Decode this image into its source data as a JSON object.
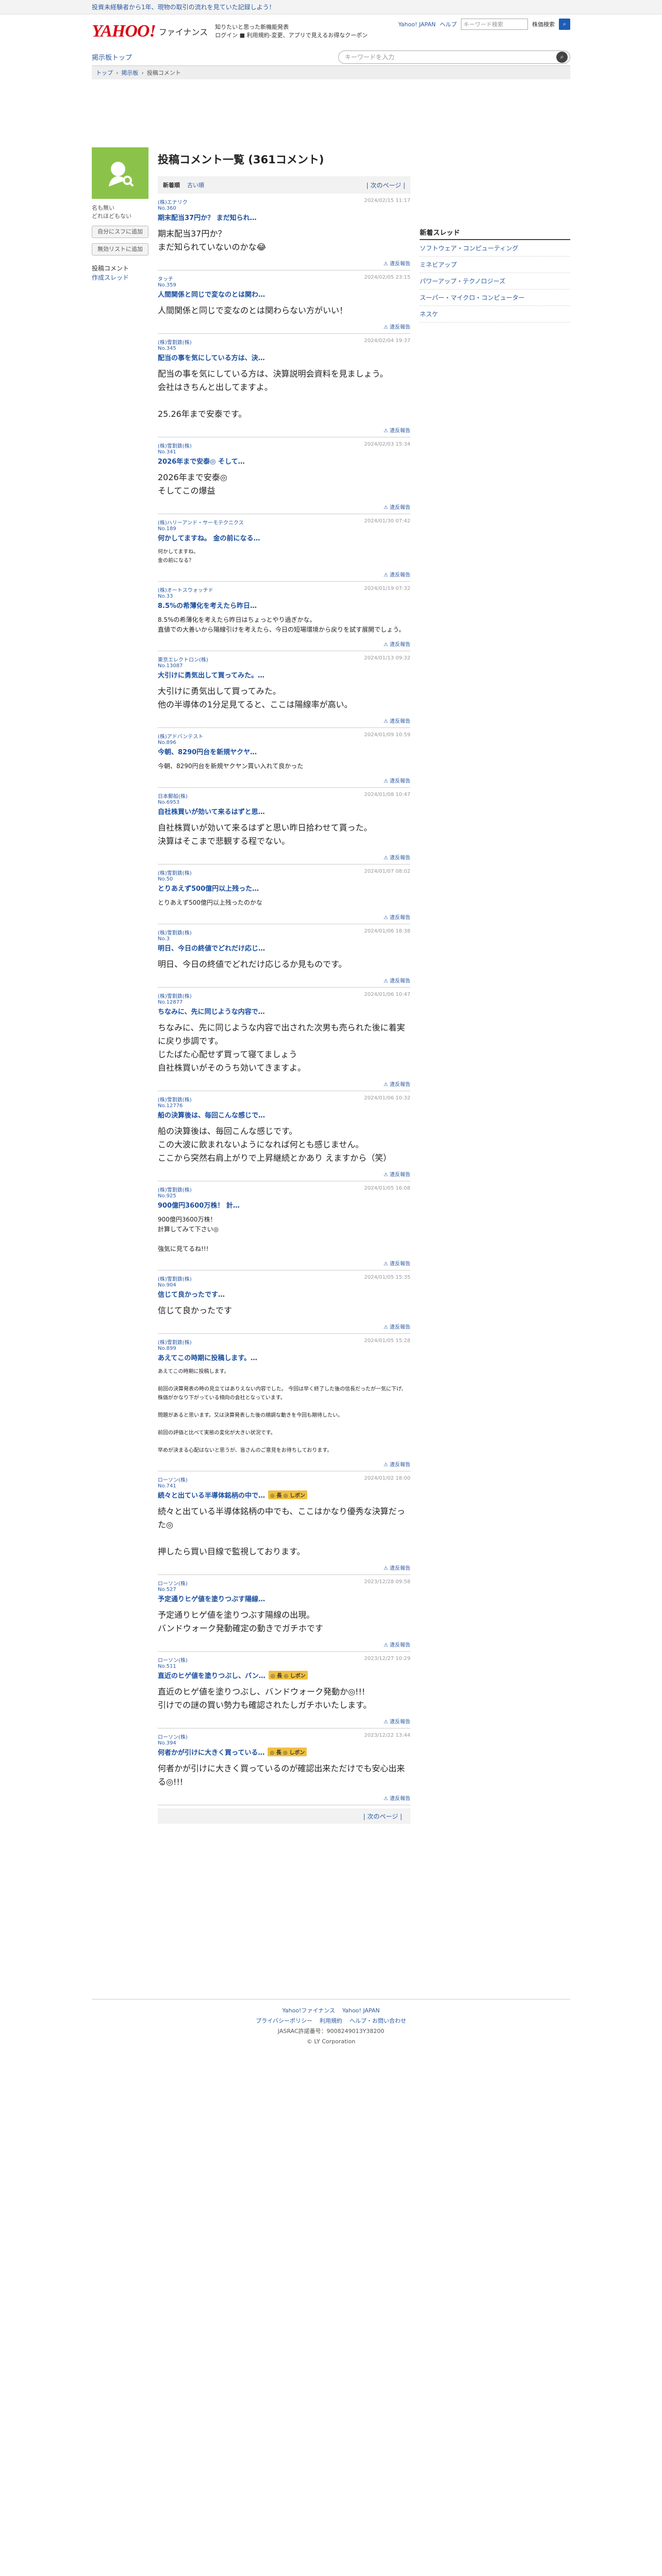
{
  "topbar": {
    "promo": "投資未経験者から1年、現物の取引の流れを見ていた記録しよう！"
  },
  "header": {
    "logo": "YAHOO!",
    "logo_jp": "JAPAN",
    "service": "ファイナンス",
    "promo_lines": [
      "知りたいと思った新機能発表",
      "ログイン ■ 利用規約-変更、アプリで見えるお得なクーポン"
    ],
    "links": [
      "Yahoo! JAPAN",
      "ヘルプ"
    ],
    "search_placeholder": "キーワード検索",
    "search_option": "株価検索"
  },
  "nav": {
    "home": "掲示板トップ",
    "search_placeholder": "キーワードを入力"
  },
  "breadcrumb": [
    "トップ",
    "掲示板",
    "投稿コメント"
  ],
  "user": {
    "name": "名も無い\nどれほどもない",
    "follow_btn": "自分にスフに追加",
    "block_btn": "無効リストに追加",
    "menu": [
      "投稿コメント",
      "作成スレッド"
    ]
  },
  "main": {
    "title": "投稿コメント一覧 (361コメント)",
    "tabs": [
      "新着順",
      "古い順"
    ],
    "pager": "| 次のページ |",
    "report": "違反報告",
    "posts": [
      {
        "stock": "(株)エナリク",
        "no": "No.360",
        "date": "2024/02/15 11:17",
        "head": "期末配当37円か？ まだ知られ…",
        "body": "期末配当37円か？\nまだ知られていないのかな😂",
        "sz": "med"
      },
      {
        "stock": "タッチ",
        "no": "No.359",
        "date": "2024/02/05 23:15",
        "head": "人間関係と同じで変なのとは関わ…",
        "body": "人間関係と同じで変なのとは関わらない方がいい！",
        "sz": "med"
      },
      {
        "stock": "(株)雪割鉄(株)",
        "no": "No.345",
        "date": "2024/02/04 19:37",
        "head": "配当の事を気にしている方は、決…",
        "body": "配当の事を気にしている方は、決算説明会資料を見ましょう。\n会社はきちんと出してますよ。\n\n25.26年まで安泰です。",
        "sz": "med"
      },
      {
        "stock": "(株)雪割鉄(株)",
        "no": "No.341",
        "date": "2024/02/03 15:34",
        "head": "2026年まで安泰◎ そして…",
        "body": "2026年まで安泰◎\nそしてこの爆益",
        "sz": "med"
      },
      {
        "stock": "(株)ハリーアンド・サーモテクニクス",
        "no": "No.189",
        "date": "2024/01/30 07:42",
        "head": "何かしてますね。 金の前になる…",
        "body": "何かしてますね。\n金の前になる？",
        "sz": "xs"
      },
      {
        "stock": "(株)オートスウォッチド",
        "no": "No.33",
        "date": "2024/01/19 07:32",
        "head": "8.5%の希薄化を考えたら昨日…",
        "body": "8.5%の希薄化を考えたら昨日はちょっとやり過ぎかな。\n直値での大善いから陽線引けを考えたら、今日の短場環境から戻りを試す展開でしょう。",
        "sz": "sm"
      },
      {
        "stock": "東京エレクトロン(株)",
        "no": "No.13087",
        "date": "2024/01/13 09:32",
        "head": "大引けに勇気出して買ってみた。…",
        "body": "大引けに勇気出して買ってみた。\n他の半導体の1分足見てると、ここは陽線率が高い。",
        "sz": "med"
      },
      {
        "stock": "(株)アドバンテスト",
        "no": "No.896",
        "date": "2024/01/09 10:59",
        "head": "今朝、8290円台を新規ヤクヤ…",
        "body": "今朝、8290円台を新規ヤクヤン買い入れて良かった",
        "sz": "sm"
      },
      {
        "stock": "日本郵船(株)",
        "no": "No.6953",
        "date": "2024/01/08 10:47",
        "head": "自社株買いが効いて来るはずと思…",
        "body": "自社株買いが効いて来るはずと思い昨日拾わせて貰った。\n決算はそこまで悲観する程でない。",
        "sz": "med"
      },
      {
        "stock": "(株)雪割鉄(株)",
        "no": "No.50",
        "date": "2024/01/07 08:02",
        "head": "とりあえず500億円以上残った…",
        "body": "とりあえず500億円以上残ったのかな",
        "sz": "sm"
      },
      {
        "stock": "(株)雪割鉄(株)",
        "no": "No.3",
        "date": "2024/01/06 18:38",
        "head": "明日、今日の終値でどれだけ応じ…",
        "body": "明日、今日の終値でどれだけ応じるか見ものです。",
        "sz": "med"
      },
      {
        "stock": "(株)雪割鉄(株)",
        "no": "No.12877",
        "date": "2024/01/06 10:47",
        "head": "ちなみに、先に同じような内容で…",
        "body": "ちなみに、先に同じような内容で出された次男も売られた後に着実に戻り歩調です。\nじたばた心配せず買って寝てましょう\n自社株買いがそのうち効いてきますよ。",
        "sz": "med"
      },
      {
        "stock": "(株)雪割鉄(株)",
        "no": "No.12776",
        "date": "2024/01/06 10:32",
        "head": "船の決算後は、毎回こんな感じで…",
        "body": "船の決算後は、毎回こんな感じです。\nこの大波に飲まれないようになれば何とも感じません。\nここから突然右肩上がりで上昇継続とかあり えますから（笑）",
        "sz": "med"
      },
      {
        "stock": "(株)雪割鉄(株)",
        "no": "No.925",
        "date": "2024/01/05 16:08",
        "head": "900億円3600万株！ 計…",
        "body": "900億円3600万株！\n計算してみて下さい◎\n\n強気に見てるね!!!",
        "sz": "sm"
      },
      {
        "stock": "(株)雪割鉄(株)",
        "no": "No.904",
        "date": "2024/01/05 15:35",
        "head": "信じて良かったです…",
        "body": "信じて良かったです",
        "sz": "med"
      },
      {
        "stock": "(株)雪割鉄(株)",
        "no": "No.899",
        "date": "2024/01/05 15:28",
        "head": "あえてこの時期に投稿します。…",
        "body": "あえてこの時期に投稿します。\n\n前回の決算発表の時の見立てはありえない内容でした。 今回は早く終了した後の信長だったが一気に下げ、株価がかなり下がっている傾向の会社となっています。\n\n問題があると思います。又は決算発表した後の順調な動きを今回も期待したい。\n\n前回の評価と比べて実態の変化が大きい状況です。\n\n早めが決まる心配はないと思うが、皆さんのご意見をお待ちしております。",
        "sz": "xs"
      },
      {
        "stock": "ローソン(株)",
        "no": "No.741",
        "date": "2024/01/02 18:00",
        "head": "続々と出ている半導体銘柄の中で…",
        "badge": "◎ 長 ◎ しボン",
        "body": "続々と出ている半導体銘柄の中でも、ここはかなり優秀な決算だった◎\n\n押したら買い目線で監視しております。",
        "sz": "med"
      },
      {
        "stock": "ローソン(株)",
        "no": "No.527",
        "date": "2023/12/28 09:58",
        "head": "予定通りヒゲ値を塗りつぶす陽線…",
        "body": "予定通りヒゲ値を塗りつぶす陽線の出現。\nバンドウォーク発動確定の動きでガチホです",
        "sz": "med"
      },
      {
        "stock": "ローソン(株)",
        "no": "No.511",
        "date": "2023/12/27 10:29",
        "head": "直近のヒゲ値を塗りつぶし、バン…",
        "badge": "◎ 長 ◎ しボン",
        "body": "直近のヒゲ値を塗りつぶし、バンドウォーク発動か◎!!!\n引けでの謎の買い勢力も確認されたしガチホいたします。",
        "sz": "med"
      },
      {
        "stock": "ローソン(株)",
        "no": "No.394",
        "date": "2023/12/22 13:44",
        "head": "何者かが引けに大きく買っている…",
        "badge": "◎ 長 ◎ しボン",
        "body": "何者かが引けに大きく買っているのが確認出来ただけでも安心出来る◎!!!",
        "sz": "med"
      }
    ]
  },
  "sidebar": {
    "title": "新着スレッド",
    "items": [
      "ソフトウェア・コンピューティング",
      "ミネビアップ",
      "パワーアップ・テクノロジーズ",
      "スーパー・マイクロ・コンピューター",
      "ネスケ"
    ]
  },
  "footer": {
    "links": [
      "Yahoo!ファイナンス",
      "Yahoo! JAPAN"
    ],
    "links2": [
      "プライバシーポリシー",
      "利用規約",
      "ヘルプ・お問い合わせ"
    ],
    "copy": "JASRAC許諾番号：9008249013Y38200\n© LY Corporation"
  }
}
